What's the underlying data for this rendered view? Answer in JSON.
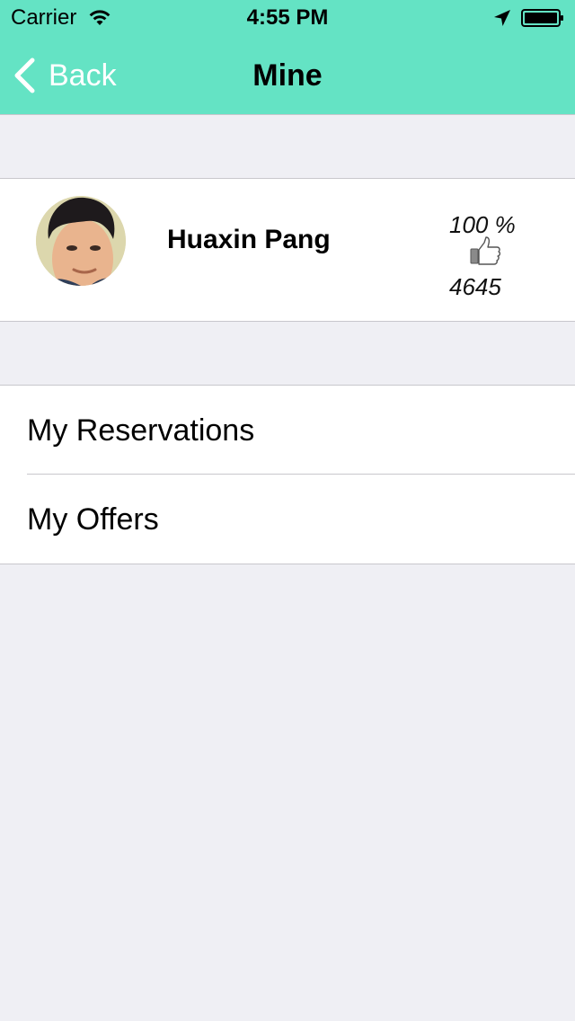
{
  "status_bar": {
    "carrier": "Carrier",
    "time": "4:55 PM",
    "wifi_icon": "wifi-icon",
    "location_icon": "location-arrow-icon",
    "battery_icon": "battery-full-icon"
  },
  "nav": {
    "back_label": "Back",
    "title": "Mine",
    "back_icon": "chevron-left-icon"
  },
  "profile": {
    "name": "Huaxin Pang",
    "rating_percent": "100 %",
    "likes_count": "4645",
    "thumb_icon": "thumbs-up-icon"
  },
  "menu": {
    "items": [
      {
        "label": "My Reservations"
      },
      {
        "label": "My Offers"
      }
    ]
  },
  "colors": {
    "header_bg": "#64e3c4",
    "page_bg": "#efeff4",
    "separator": "#c8c7cc",
    "back_text": "#ffffff"
  }
}
